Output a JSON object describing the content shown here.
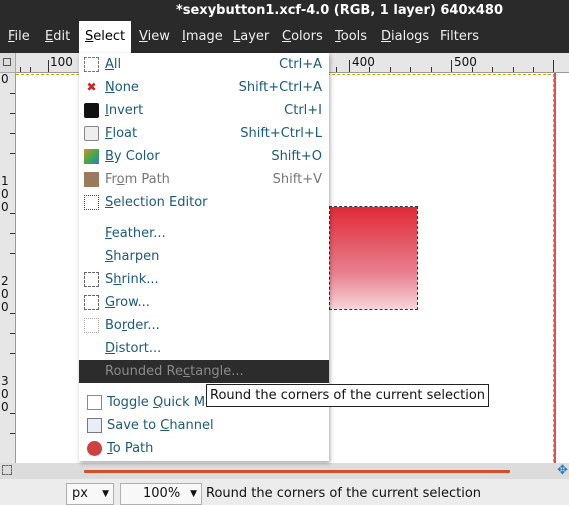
{
  "window": {
    "title": "*sexybutton1.xcf-4.0 (RGB, 1 layer) 640x480"
  },
  "menubar": [
    {
      "label": "File",
      "mn": "F",
      "rest": "ile",
      "active": false
    },
    {
      "label": "Edit",
      "mn": "E",
      "rest": "dit",
      "active": false
    },
    {
      "label": "Select",
      "mn": "S",
      "rest": "elect",
      "active": true
    },
    {
      "label": "View",
      "mn": "V",
      "rest": "iew",
      "active": false
    },
    {
      "label": "Image",
      "mn": "I",
      "rest": "mage",
      "active": false
    },
    {
      "label": "Layer",
      "mn": "L",
      "rest": "ayer",
      "active": false
    },
    {
      "label": "Colors",
      "mn": "C",
      "rest": "olors",
      "active": false
    },
    {
      "label": "Tools",
      "mn": "T",
      "rest": "ools",
      "active": false
    },
    {
      "label": "Dialogs",
      "mn": "D",
      "rest": "ialogs",
      "active": false
    },
    {
      "label": "Filters",
      "mn": "",
      "rest": "Filters",
      "active": false
    }
  ],
  "ruler": {
    "h_labels": [
      "100",
      "400",
      "500"
    ],
    "v_labels": [
      "0",
      "1 0 0",
      "2 0 0",
      "3 0 0"
    ]
  },
  "select_menu": {
    "items": [
      {
        "name": "all",
        "icon": "select-all-icon",
        "pre": "",
        "u": "A",
        "post": "ll",
        "shortcut": "Ctrl+A"
      },
      {
        "name": "none",
        "icon": "select-none-icon",
        "pre": "",
        "u": "N",
        "post": "one",
        "shortcut": "Shift+Ctrl+A"
      },
      {
        "name": "invert",
        "icon": "invert-selection-icon",
        "pre": "",
        "u": "I",
        "post": "nvert",
        "shortcut": "Ctrl+I"
      },
      {
        "name": "float",
        "icon": "float-selection-icon",
        "pre": "",
        "u": "F",
        "post": "loat",
        "shortcut": "Shift+Ctrl+L"
      },
      {
        "name": "by-color",
        "icon": "select-by-color-icon",
        "pre": "",
        "u": "B",
        "post": "y Color",
        "shortcut": "Shift+O"
      },
      {
        "name": "from-path",
        "icon": "selection-from-path-icon",
        "pre": "Fr",
        "u": "o",
        "post": "m Path",
        "shortcut": "Shift+V"
      },
      {
        "name": "selection-editor",
        "icon": "selection-editor-icon",
        "pre": "",
        "u": "S",
        "post": "election Editor",
        "shortcut": ""
      },
      {
        "name": "feather",
        "icon": "",
        "pre": "",
        "u": "F",
        "post": "eather...",
        "shortcut": ""
      },
      {
        "name": "sharpen",
        "icon": "",
        "pre": "",
        "u": "S",
        "post": "harpen",
        "shortcut": ""
      },
      {
        "name": "shrink",
        "icon": "shrink-selection-icon",
        "pre": "S",
        "u": "h",
        "post": "rink...",
        "shortcut": ""
      },
      {
        "name": "grow",
        "icon": "grow-selection-icon",
        "pre": "",
        "u": "G",
        "post": "row...",
        "shortcut": ""
      },
      {
        "name": "border",
        "icon": "border-selection-icon",
        "pre": "Bo",
        "u": "r",
        "post": "der...",
        "shortcut": ""
      },
      {
        "name": "distort",
        "icon": "",
        "pre": "",
        "u": "D",
        "post": "istort...",
        "shortcut": ""
      },
      {
        "name": "rounded-rectangle",
        "icon": "",
        "pre": "Rounded Re",
        "u": "c",
        "post": "tangle...",
        "shortcut": ""
      },
      {
        "name": "toggle-quick-mask",
        "icon": "toggle-quick-mask-icon",
        "pre": "Toggle ",
        "u": "Q",
        "post": "uick Mask",
        "shortcut": ""
      },
      {
        "name": "save-to-channel",
        "icon": "save-to-channel-icon",
        "pre": "Save to ",
        "u": "C",
        "post": "hannel",
        "shortcut": ""
      },
      {
        "name": "to-path",
        "icon": "to-path-icon",
        "pre": "",
        "u": "T",
        "post": "o Path",
        "shortcut": ""
      }
    ]
  },
  "tooltip": {
    "text": "Round the corners of the current selection"
  },
  "statusbar": {
    "unit": "px",
    "zoom": "100%",
    "message": "Round the corners of the current selection"
  },
  "colors": {
    "menubar_bg": "#2a2a2a",
    "menu_text": "#1a5a7a",
    "highlight_bg": "#2c2c2c",
    "gradient_top": "#e02a35",
    "gradient_bottom": "#f6d5d8"
  }
}
